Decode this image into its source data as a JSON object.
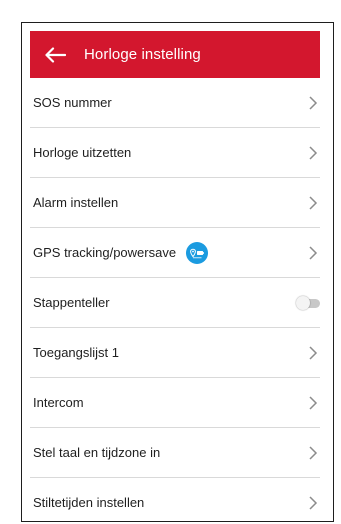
{
  "header": {
    "title": "Horloge instelling"
  },
  "colors": {
    "header_bg": "#d3172e",
    "gps_badge": "#1b9be0",
    "text": "#1f1f1f",
    "divider": "#d9d9d9"
  },
  "menu": {
    "items": [
      {
        "label": "SOS nummer",
        "control": "chevron"
      },
      {
        "label": "Horloge uitzetten",
        "control": "chevron"
      },
      {
        "label": "Alarm instellen",
        "control": "chevron"
      },
      {
        "label": "GPS tracking/powersave",
        "control": "chevron",
        "icon": "gps-powersave-icon"
      },
      {
        "label": "Stappenteller",
        "control": "toggle",
        "toggle_on": false
      },
      {
        "label": "Toegangslijst 1",
        "control": "chevron"
      },
      {
        "label": "Intercom",
        "control": "chevron"
      },
      {
        "label": "Stel taal en tijdzone in",
        "control": "chevron"
      },
      {
        "label": "Stiltetijden instellen",
        "control": "chevron"
      }
    ]
  }
}
